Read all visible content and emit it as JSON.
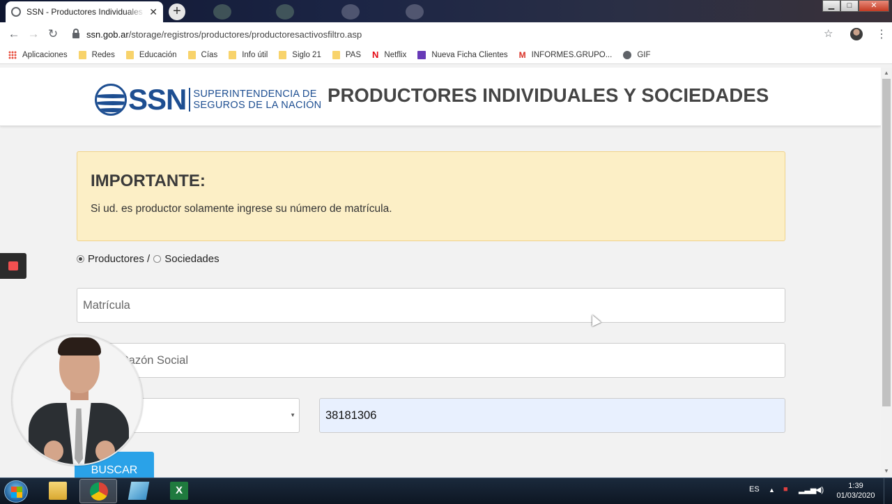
{
  "browser": {
    "tab_title": "SSN - Productores Individuales y Sociedades",
    "tab_close": "✕",
    "new_tab": "+",
    "url_host": "ssn.gob.ar",
    "url_path": "/storage/registros/productores/productoresactivosfiltro.asp",
    "window_controls": {
      "minimize": "▁",
      "maximize": "□",
      "close": "✕"
    }
  },
  "bookmarks": [
    {
      "label": "Aplicaciones",
      "icon": "apps-icon"
    },
    {
      "label": "Redes",
      "icon": "folder-icon"
    },
    {
      "label": "Educación",
      "icon": "folder-icon"
    },
    {
      "label": "Cías",
      "icon": "folder-icon"
    },
    {
      "label": "Info útil",
      "icon": "folder-icon"
    },
    {
      "label": "Siglo 21",
      "icon": "folder-icon"
    },
    {
      "label": "PAS",
      "icon": "folder-icon"
    },
    {
      "label": "Netflix",
      "icon": "netflix-icon"
    },
    {
      "label": "Nueva Ficha Clientes",
      "icon": "sheets-icon"
    },
    {
      "label": "INFORMES.GRUPO...",
      "icon": "gmail-icon"
    },
    {
      "label": "GIF",
      "icon": "globe-icon"
    }
  ],
  "header": {
    "logo_ssn": "SSN",
    "logo_line1": "SUPERINTENDENCIA DE",
    "logo_line2": "SEGUROS DE LA NACIÓN",
    "title": "PRODUCTORES INDIVIDUALES Y SOCIEDADES"
  },
  "alert": {
    "title": "IMPORTANTE:",
    "text": "Si ud. es productor solamente ingrese su número de matrícula."
  },
  "form": {
    "radio_productores": "Productores /",
    "radio_sociedades": "Sociedades",
    "selected_radio": "productores",
    "matricula_placeholder": "Matrícula",
    "razon_visible": "o Razón Social",
    "dropdown_value": "",
    "document_value": "38181306",
    "search_button": "BUSCAR"
  },
  "taskbar": {
    "language": "ES",
    "time": "1:39",
    "date": "01/03/2020"
  },
  "colors": {
    "brand_blue": "#1d4e91",
    "alert_bg": "#fcefc6",
    "button_blue": "#2aa2e8",
    "autofill_bg": "#e8f0fe"
  }
}
